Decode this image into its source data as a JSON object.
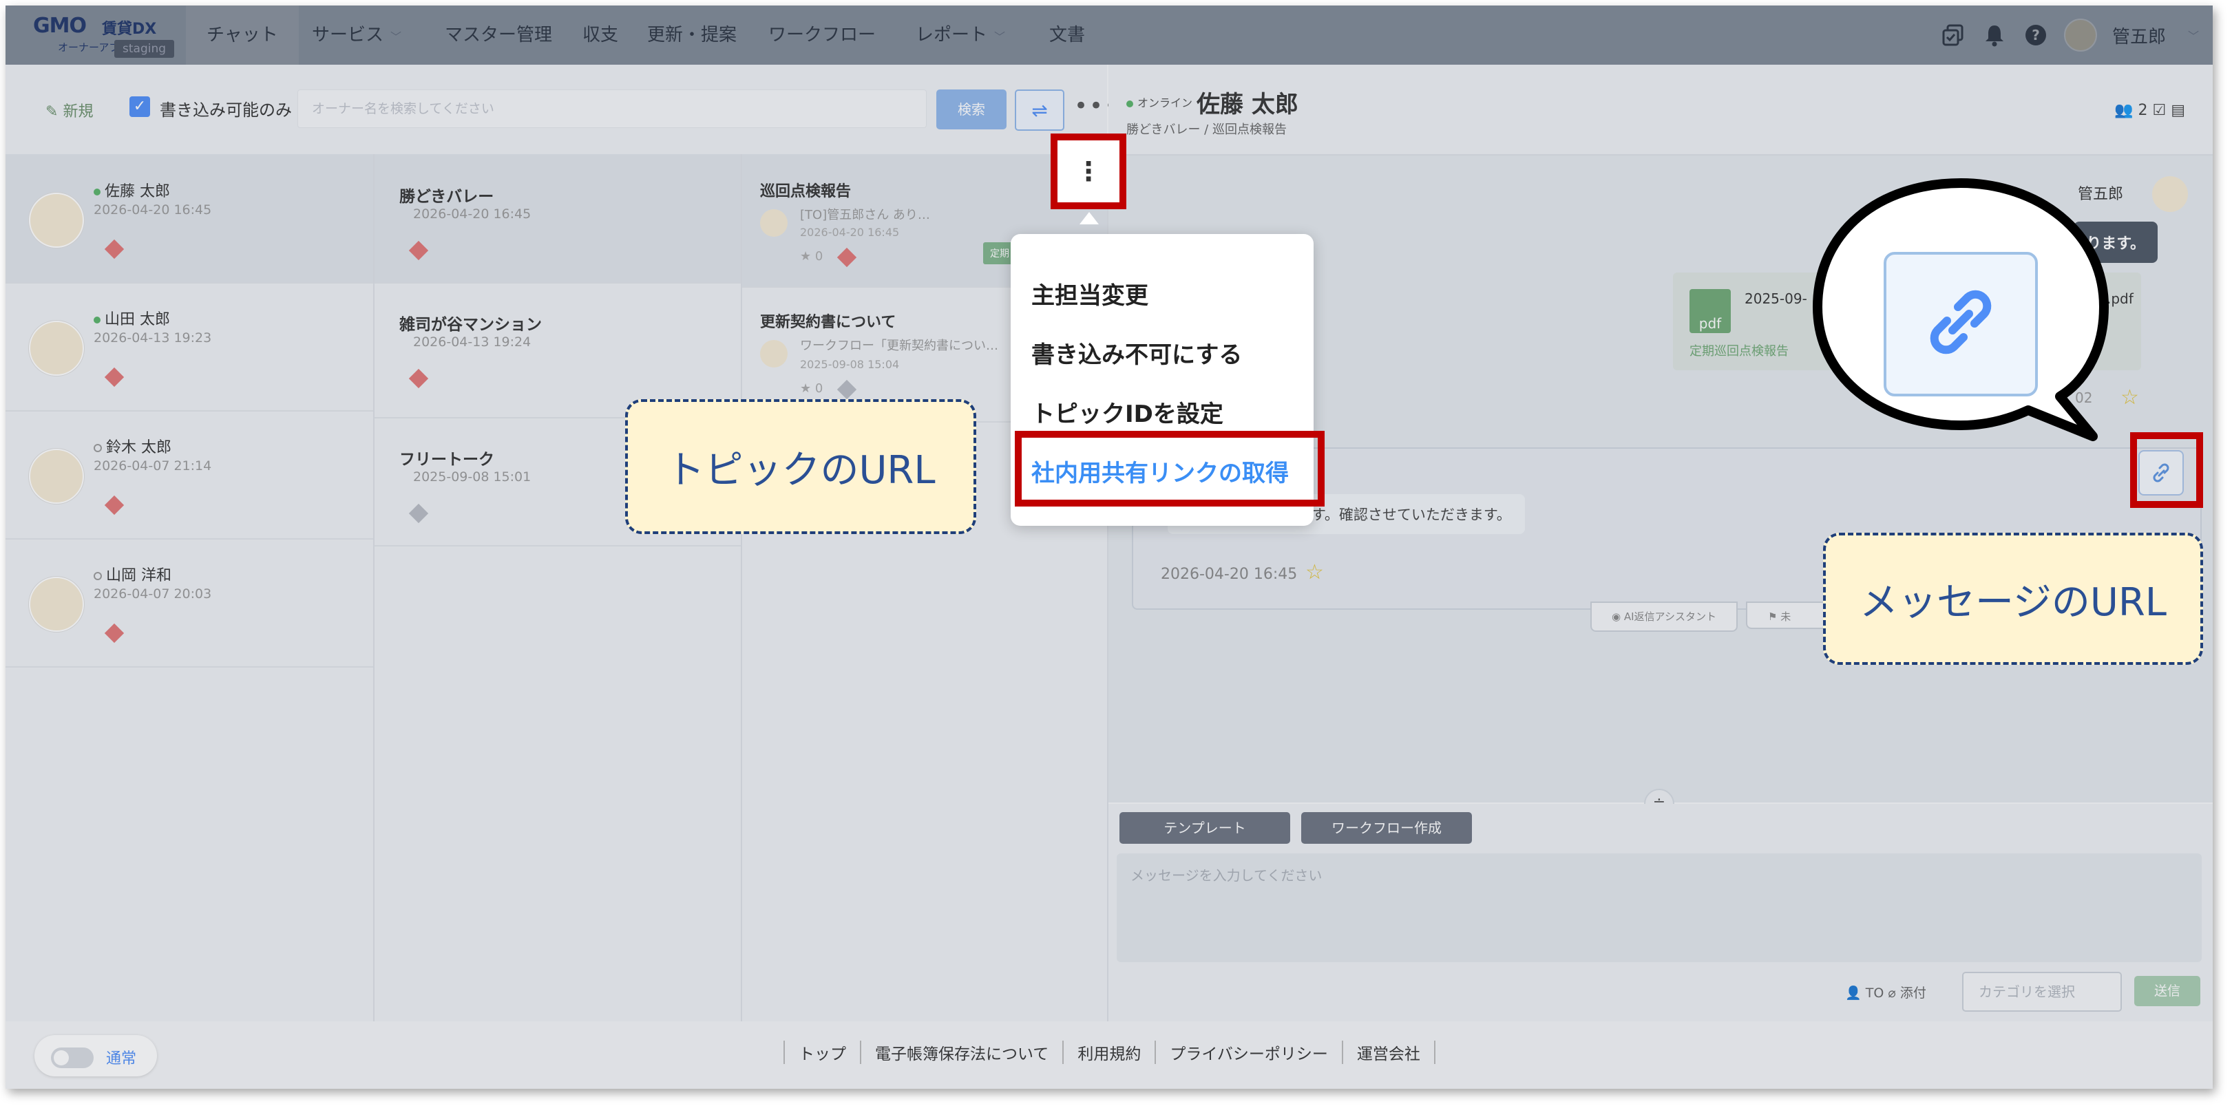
{
  "nav": {
    "logo_brand": "GMO",
    "logo_product": "賃貸DX",
    "logo_sub": "オーナーアプリ",
    "env_badge": "staging",
    "items": [
      "チャット",
      "サービス",
      "マスター管理",
      "収支",
      "更新・提案",
      "ワークフロー",
      "レポート",
      "文書"
    ],
    "user_name": "管五郎"
  },
  "toolbar": {
    "new_label": "新規",
    "writable_only_label": "書き込み可能のみ",
    "search_placeholder": "オーナー名を検索してください",
    "search_button": "検索"
  },
  "owners": [
    {
      "name": "佐藤 太郎",
      "date": "2026-04-20 16:45",
      "online": true
    },
    {
      "name": "山田 太郎",
      "date": "2026-04-13 19:23",
      "online": true
    },
    {
      "name": "鈴木 太郎",
      "date": "2026-04-07 21:14",
      "online": false
    },
    {
      "name": "山岡 洋和",
      "date": "2026-04-07 20:03",
      "online": false
    }
  ],
  "properties": [
    {
      "name": "勝どきバレー",
      "date": "2026-04-20 16:45"
    },
    {
      "name": "雑司が谷マンション",
      "date": "2026-04-13 19:24"
    },
    {
      "name": "フリートーク",
      "date": "2025-09-08 15:01"
    }
  ],
  "topics": [
    {
      "title": "巡回点検報告",
      "snippet": "[TO]管五郎さん あり…",
      "time": "2026-04-20 16:45",
      "stars": "★ 0",
      "tag": "定期"
    },
    {
      "title": "更新契約書について",
      "snippet": "ワークフロー「更新契約書につい…",
      "time": "2025-09-08 15:04",
      "stars": "★ 0"
    }
  ],
  "context_menu": {
    "items": [
      "主担当変更",
      "書き込み不可にする",
      "トピックIDを設定",
      "社内用共有リンクの取得"
    ]
  },
  "chat": {
    "status": "オンライン",
    "owner_name": "佐藤 太郎",
    "breadcrumb": "勝どきバレー / 巡回点検報告",
    "member_count": "2",
    "sender_name": "管五郎",
    "dark_message": "ります。",
    "file_date": "2025-09-",
    "file_name": ".pdf",
    "file_sub": "定期巡回点検報告",
    "file_icon": "pdf",
    "file_time": "02",
    "message_text": "ありがとうございます。確認させていただきます。",
    "message_time": "2026-04-20 16:45",
    "ai_assistant_label": "AI返信アシスタント",
    "second_action_label": "未"
  },
  "composer": {
    "template_button": "テンプレート",
    "workflow_button": "ワークフロー作成",
    "input_placeholder": "メッセージを入力してください",
    "to_label": "TO",
    "attach_label": "添付",
    "category_placeholder": "カテゴリを選択",
    "send_button": "送信"
  },
  "footer": {
    "mode_label": "通常",
    "links": [
      "トップ",
      "電子帳簿保存法について",
      "利用規約",
      "プライバシーポリシー",
      "運営会社"
    ]
  },
  "annotations": {
    "topic_url": "トピックのURL",
    "message_url": "メッセージのURL"
  },
  "colors": {
    "highlight_red": "#c00000",
    "callout_fill": "#fff4d2",
    "callout_border": "#1f3f7a",
    "link_blue": "#3a8ef5"
  }
}
